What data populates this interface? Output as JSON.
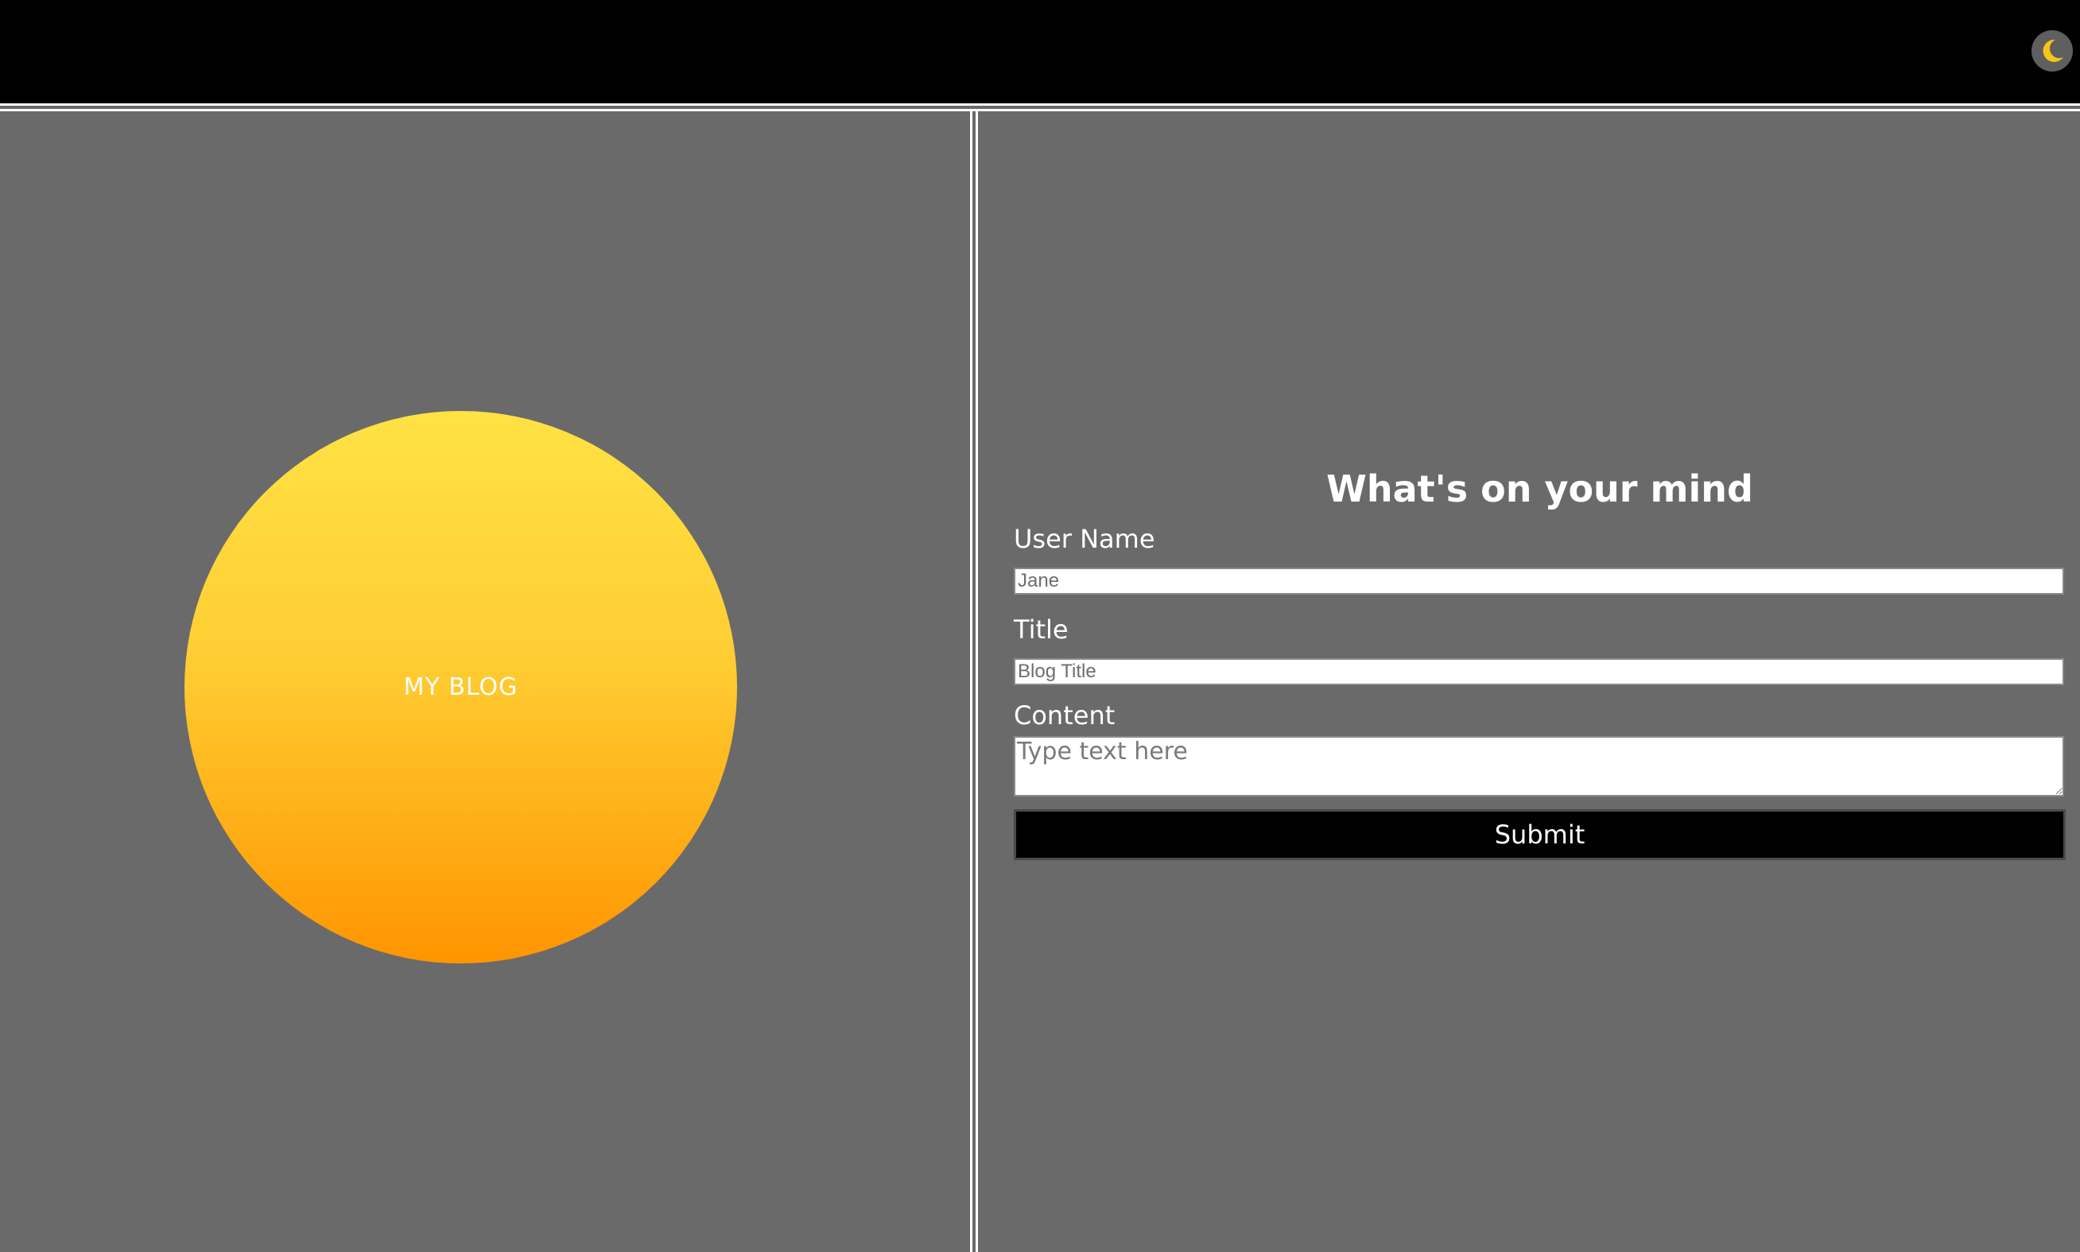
{
  "header": {
    "theme_toggle_icon": "moon-icon",
    "moon_color": "#f5c518",
    "toggle_bg": "#5f5f5f"
  },
  "logo": {
    "label": "MY BLOG",
    "gradient_top": "#ffe244",
    "gradient_bottom": "#ff9500"
  },
  "form": {
    "heading": "What's on your mind",
    "username": {
      "label": "User Name",
      "placeholder": "Jane",
      "value": ""
    },
    "title": {
      "label": "Title",
      "placeholder": "Blog Title",
      "value": ""
    },
    "content": {
      "label": "Content",
      "placeholder": "Type text here",
      "value": ""
    },
    "submit_label": "Submit"
  }
}
